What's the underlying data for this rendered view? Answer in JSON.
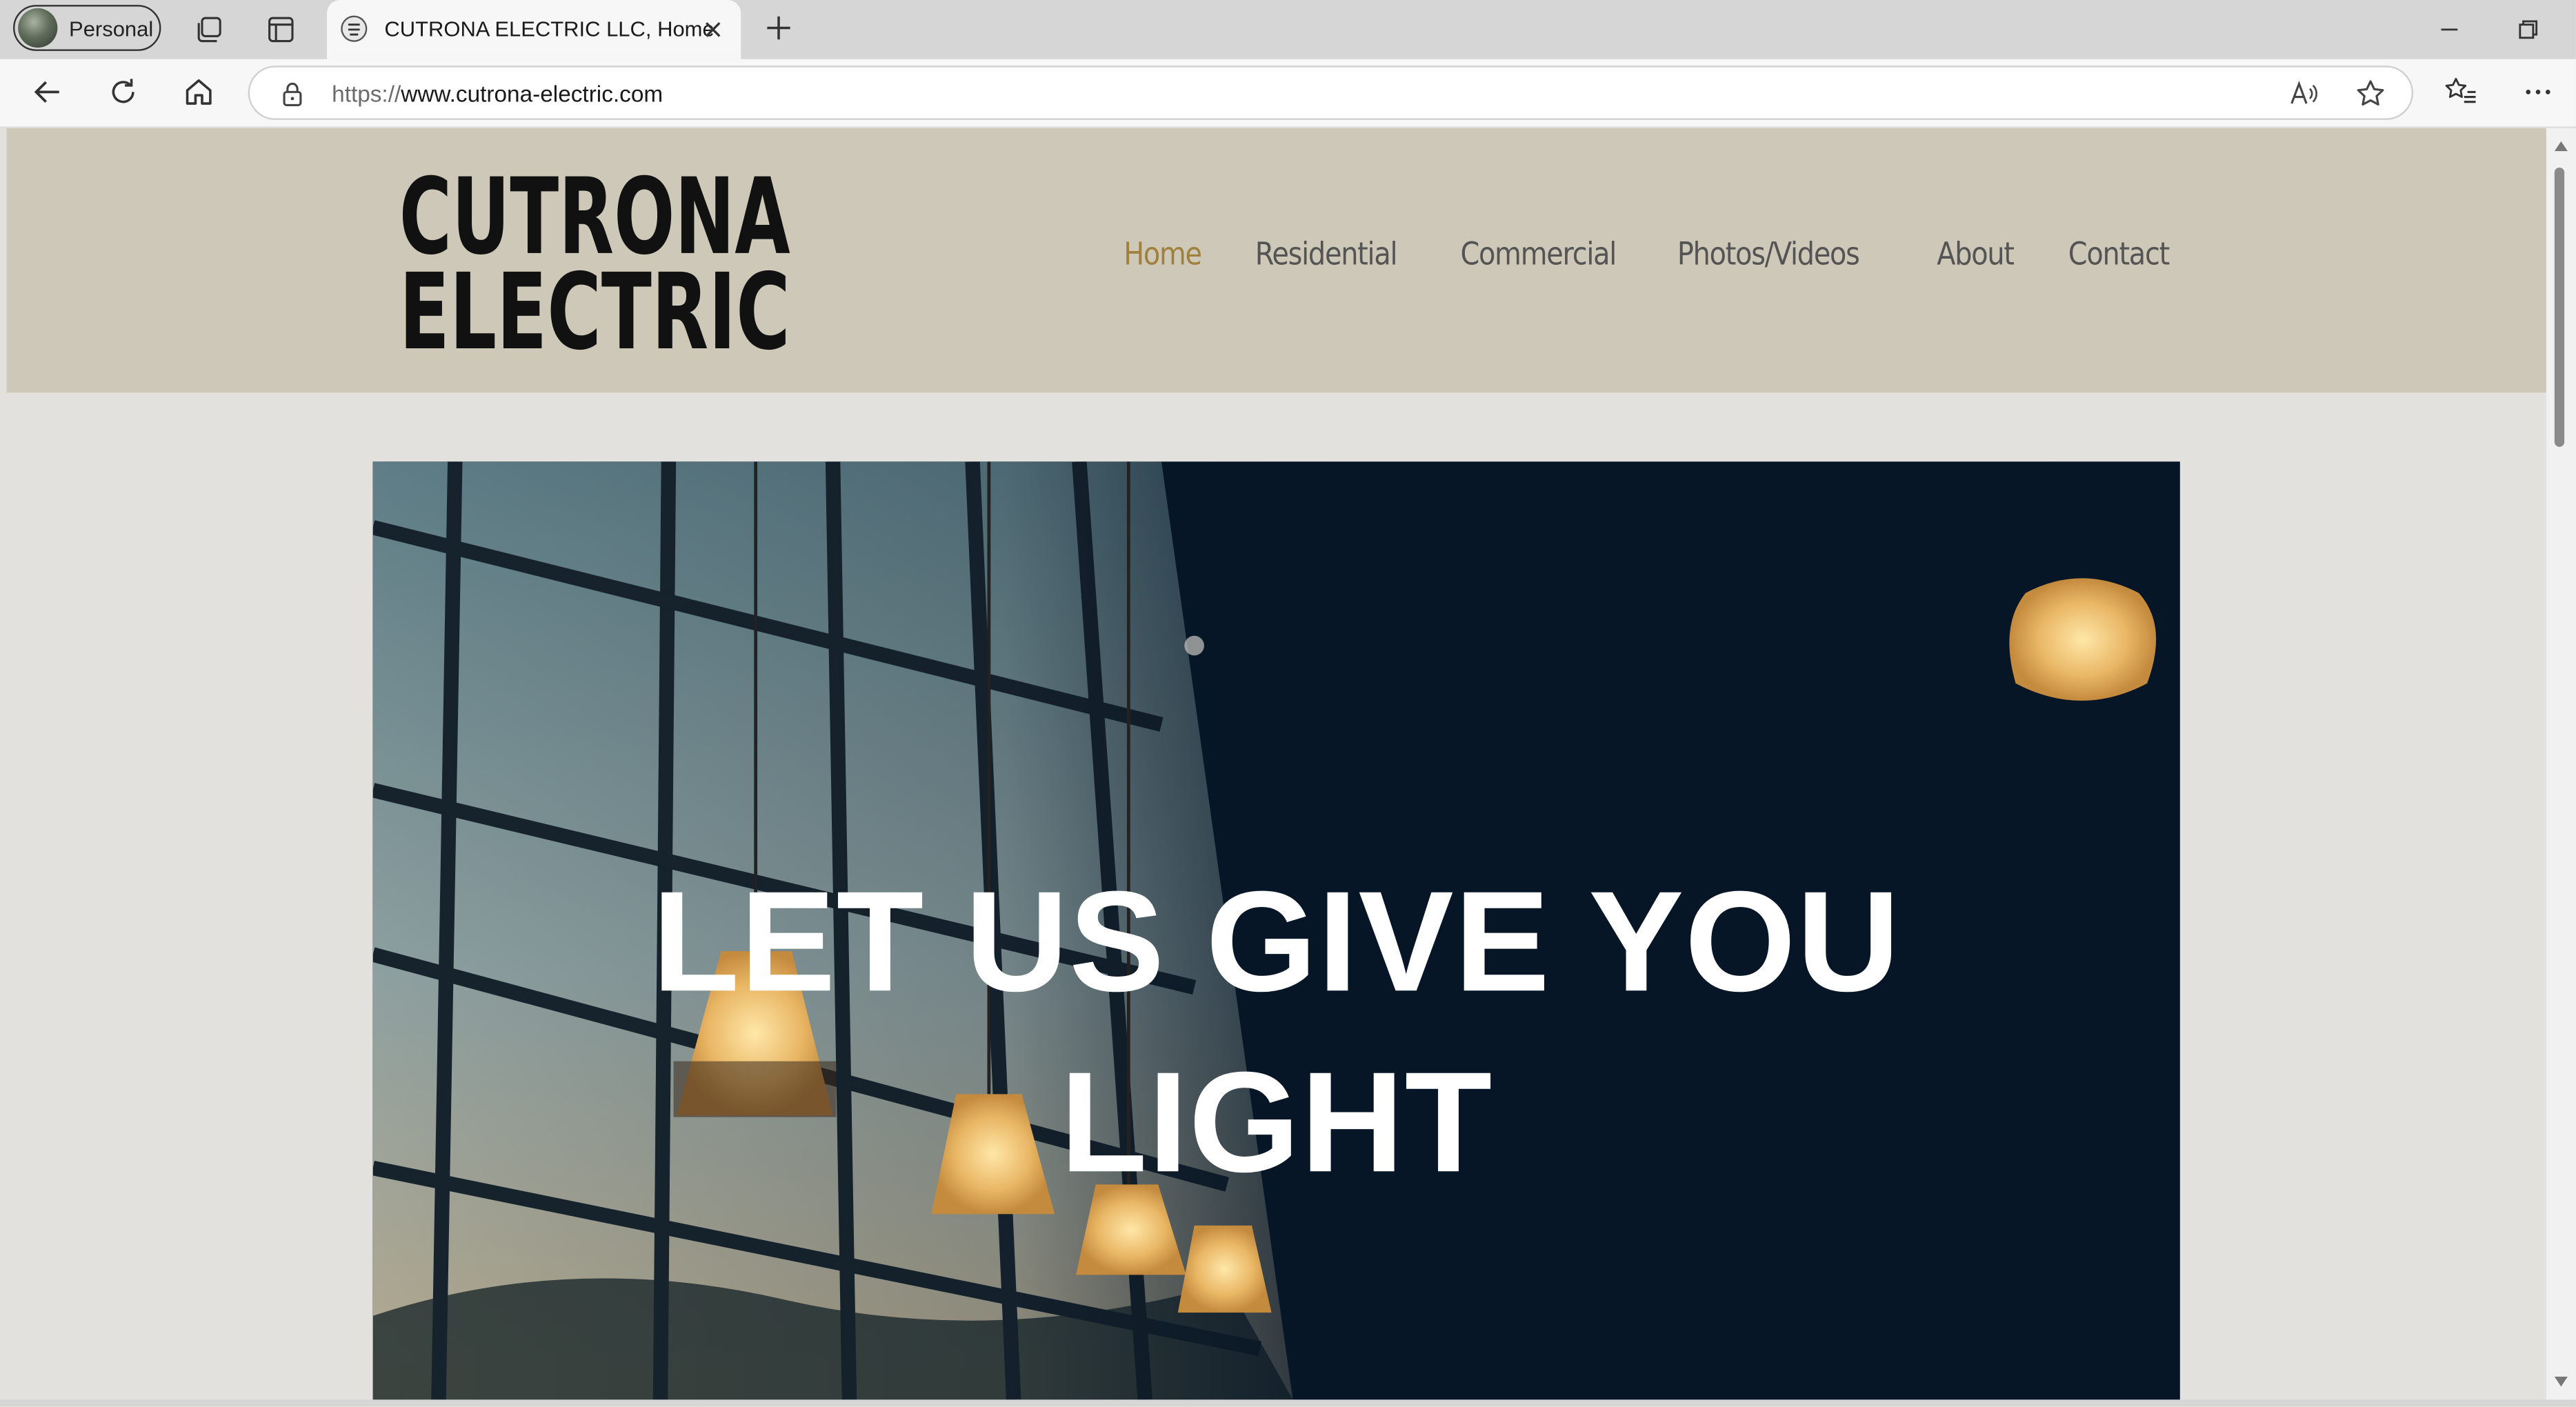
{
  "browser": {
    "profile_label": "Personal",
    "tab_title": "CUTRONA ELECTRIC LLC, Home",
    "url_scheme": "https://",
    "url_host": "www.cutrona-electric.com",
    "icons": [
      "workspaces-icon",
      "tab-actions-icon",
      "close-tab-icon",
      "new-tab-icon",
      "minimize-icon",
      "restore-icon",
      "back-icon",
      "refresh-icon",
      "home-icon",
      "lock-icon",
      "read-aloud-icon",
      "favorite-star-icon",
      "favorites-icon",
      "more-icon"
    ]
  },
  "site": {
    "logo_line1": "CUTRONA",
    "logo_line2": "ELECTRIC",
    "nav": [
      "Home",
      "Residential",
      "Commercial",
      "Photos/Videos",
      "About",
      "Contact"
    ],
    "active_nav": "Home",
    "hero_line1": "LET US GIVE YOU",
    "hero_line2": "LIGHT"
  },
  "colors": {
    "header_bg": "#cdc8b8",
    "page_bg": "#e2e1dd",
    "nav_text": "#545454",
    "nav_active": "#a0803c",
    "hero_bg": "#071626"
  }
}
